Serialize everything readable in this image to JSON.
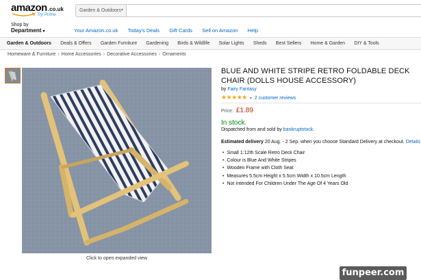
{
  "header": {
    "logo_text": "amazon",
    "logo_suffix": ".co.uk",
    "logo_prime": "Try Prime",
    "search_category": "Garden & Outdoors",
    "search_value": ""
  },
  "nav": {
    "shop_by_line1": "Shop by",
    "shop_by_line2": "Department",
    "links": [
      "Your Amazon.co.uk",
      "Today's Deals",
      "Gift Cards",
      "Sell on Amazon",
      "Help"
    ]
  },
  "category_bar": {
    "items": [
      "Garden & Outdoors",
      "Deals & Offers",
      "Garden Furniture",
      "Gardening",
      "Birds & Wildlife",
      "Solar Lights",
      "Sheds",
      "Best Sellers",
      "Home & Garden",
      "DIY & Tools"
    ]
  },
  "breadcrumb": [
    "Homeware & Furniture",
    "Home Accessories",
    "Decorative Accessories",
    "Ornaments"
  ],
  "breadcrumb_separator": "›",
  "gallery": {
    "caption": "Click to open expanded view"
  },
  "product": {
    "title": "BLUE AND WHITE STRIPE RETRO FOLDABLE DECK CHAIR (DOLLS HOUSE ACCESSORY)",
    "by_prefix": "by",
    "brand": "Fairy Fantasy",
    "stars": "★★★★★",
    "rating_out_of_5": 5,
    "reviews_link": "2 customer reviews",
    "price_label": "Price:",
    "price": "£1.89",
    "stock": "In stock.",
    "dispatch_text": "Dispatched from and sold by",
    "seller": "bankruptstock",
    "dispatch_end": ".",
    "delivery_label": "Estimated delivery",
    "delivery_text": "20 Aug. - 2 Sep. when you choose Standard Delivery at checkout.",
    "delivery_link": "Details",
    "bullets": [
      "Small 1:12th Scale Retro Deck Chair",
      "Colour is Blue And White Stripes",
      "Wooden Frame with Cloth Seat",
      "Measures 5.5cm Height x 5.5cm Width x 10.5cm Length",
      "Not Intended For Children Under The Age Of 4 Years Old"
    ]
  },
  "watermark": "funpeer.com",
  "colors": {
    "link": "#0066c0",
    "price": "#b12704",
    "in_stock": "#008a00",
    "stars": "#f0a81e",
    "thumb_border": "#e47911"
  }
}
